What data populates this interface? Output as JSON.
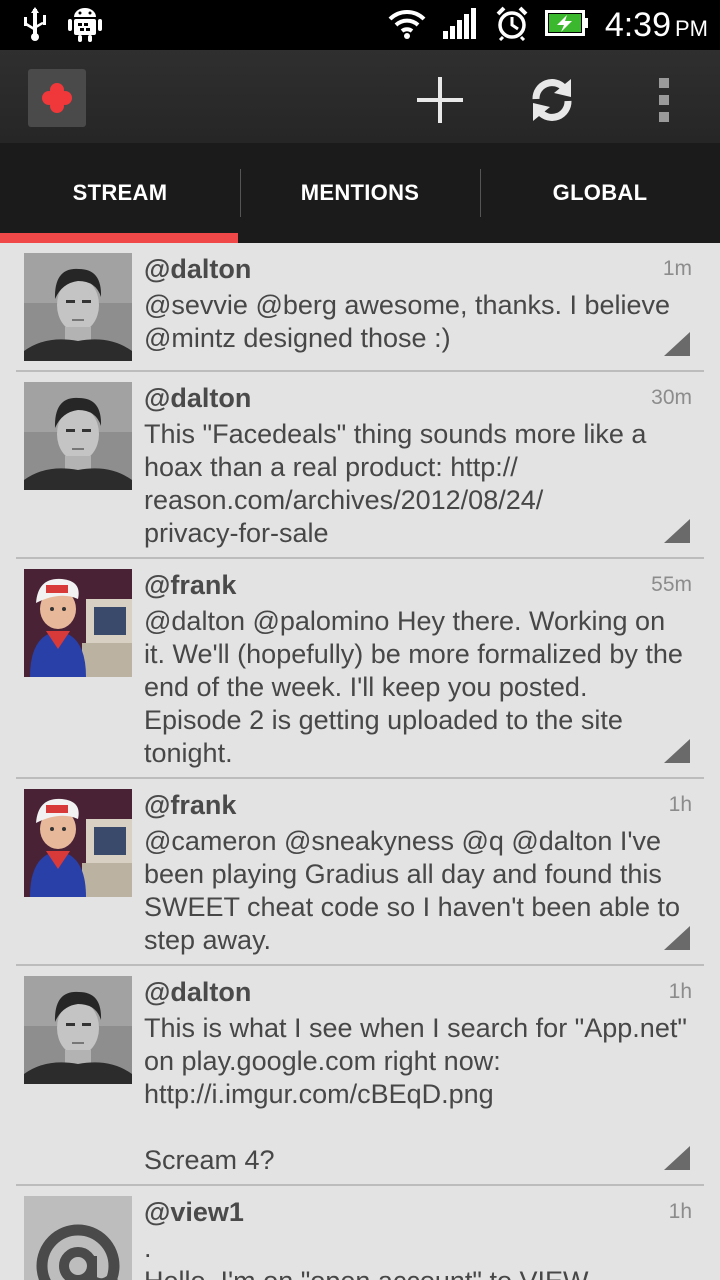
{
  "status_bar": {
    "left_icons": [
      "usb-icon",
      "android-debug-icon"
    ],
    "right_icons": [
      "wifi-icon",
      "signal-icon",
      "alarm-icon",
      "battery-charging-icon"
    ],
    "time": "4:39",
    "ampm": "PM"
  },
  "action_bar": {
    "logo_icon": "app-logo-icon",
    "buttons": [
      {
        "icon": "plus-icon"
      },
      {
        "icon": "refresh-icon"
      },
      {
        "icon": "overflow-menu-icon"
      }
    ]
  },
  "tabs": [
    {
      "label": "STREAM",
      "active": true
    },
    {
      "label": "MENTIONS",
      "active": false
    },
    {
      "label": "GLOBAL",
      "active": false
    }
  ],
  "accent_color": "#f04848",
  "posts": [
    {
      "user": "@dalton",
      "time": "1m",
      "text": "@sevvie @berg awesome, thanks. I believe @mintz designed those :)",
      "avatar": "dalton-avatar"
    },
    {
      "user": "@dalton",
      "time": "30m",
      "text": "This \"Facedeals\" thing sounds more like a hoax than a real product: http://\nreason.com/archives/2012/08/24/\nprivacy-for-sale",
      "avatar": "dalton-avatar"
    },
    {
      "user": "@frank",
      "time": "55m",
      "text": "@dalton @palomino Hey there. Working on it. We'll (hopefully) be more formalized by the end of the week. I'll keep you posted. Episode 2 is getting uploaded to the site tonight.",
      "avatar": "frank-avatar"
    },
    {
      "user": "@frank",
      "time": "1h",
      "text": "@cameron @sneakyness @q @dalton I've been playing Gradius all day and found this SWEET cheat code so I haven't been able to step away.",
      "avatar": "frank-avatar"
    },
    {
      "user": "@dalton",
      "time": "1h",
      "text": "This is what I see when I search for \"App.net\" on play.google.com right now: http://i.imgur.com/cBEqD.png\n\nScream 4?",
      "avatar": "dalton-avatar"
    },
    {
      "user": "@view1",
      "time": "1h",
      "text": ".\nHello. I'm on \"open account\" to VIEW",
      "avatar": "at-sign-avatar"
    }
  ]
}
